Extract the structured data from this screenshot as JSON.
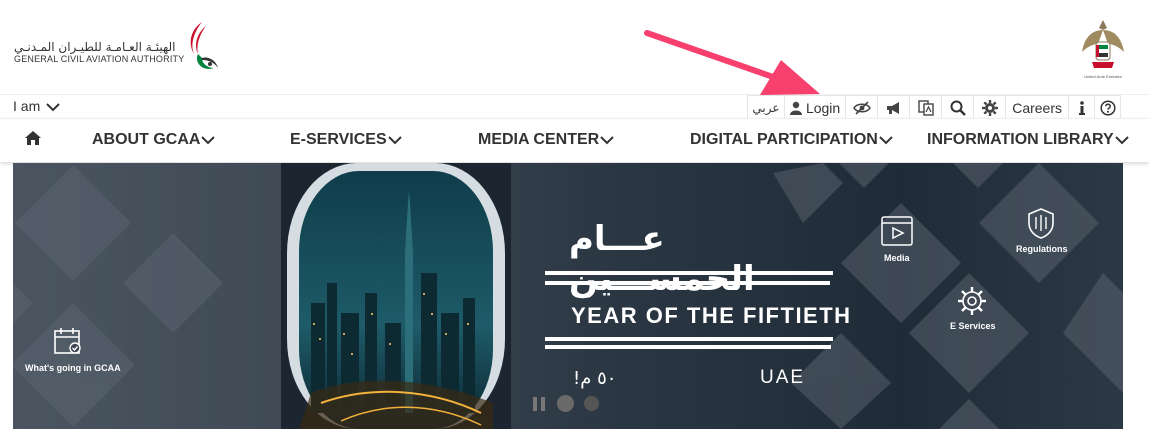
{
  "header": {
    "logo_arabic": "الهيئـة العـامـة للطيـران المـدنـي",
    "logo_english": "GENERAL CIVIL AVIATION AUTHORITY",
    "emblem_caption": "United Arab Emirates"
  },
  "utility": {
    "iam_label": "I am",
    "arabic_label": "عربي",
    "login_label": "Login",
    "careers_label": "Careers",
    "icons": [
      "user-icon",
      "eye-slash-icon",
      "megaphone-icon",
      "translate-icon",
      "search-icon",
      "gear-icon",
      "info-icon",
      "help-icon"
    ]
  },
  "nav": {
    "items": [
      {
        "label": "ABOUT GCAA"
      },
      {
        "label": "E-SERVICES"
      },
      {
        "label": "MEDIA CENTER"
      },
      {
        "label": "DIGITAL PARTICIPATION"
      },
      {
        "label": "INFORMATION LIBRARY"
      }
    ]
  },
  "hero": {
    "arabic_title": "عـــام الخمســـين",
    "english_title": "YEAR OF THE FIFTIETH",
    "arabic_number": "!٥٠ م",
    "uae": "UAE",
    "tiles": {
      "whats_going": "What's going in GCAA",
      "media": "Media",
      "regulations": "Regulations",
      "eservices": "E Services"
    }
  },
  "colors": {
    "arrow": "#f7406e",
    "logo_red": "#c8102e",
    "logo_green": "#00843d"
  }
}
